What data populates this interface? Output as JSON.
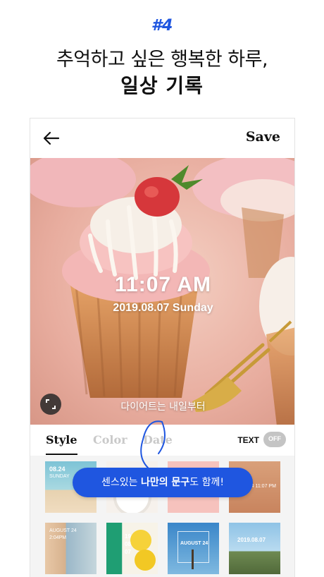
{
  "promo": {
    "number": "#4",
    "headline_line1": "추억하고 싶은 행복한 하루,",
    "headline_line2": "일상 기록"
  },
  "appbar": {
    "back_icon": "arrow-left-icon",
    "save_label": "Save"
  },
  "photo": {
    "time": "11:07 AM",
    "date": "2019.08.07 Sunday",
    "caption": "다이어트는 내일부터",
    "expand_icon": "expand-icon"
  },
  "tabs": {
    "style_label": "Style",
    "color_label": "Color",
    "date_label": "Date",
    "active": "Style"
  },
  "text_toggle": {
    "label": "TEXT",
    "state": "OFF"
  },
  "thumbnails": {
    "t1_line1": "08.24",
    "t1_line2": "SUNDAY",
    "t4_text": "08.24 11:07 PM",
    "t5_line1": "AUGUST 24",
    "t5_line2": "2:04PM",
    "t6_text": "19 08 07",
    "t7_text": "AUGUST 24",
    "t8_text": "2019.08.07"
  },
  "callout": {
    "prefix": "센스있는 ",
    "bold": "나만의 문구",
    "suffix": "도 함께!"
  },
  "colors": {
    "accent": "#1f56e0",
    "toggle_off": "#c4c4c4",
    "tab_inactive": "#c9c9c9"
  }
}
